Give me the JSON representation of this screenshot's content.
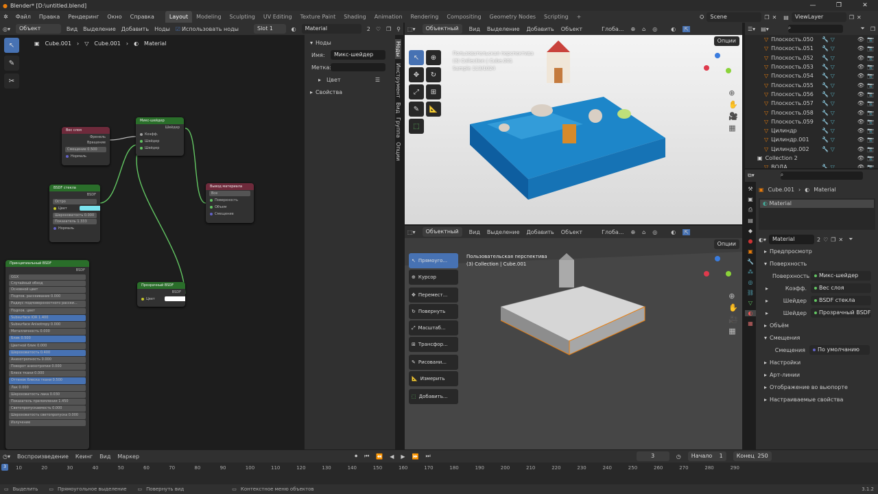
{
  "window": {
    "title": "Blender* [D:\\untitled.blend]",
    "min": "—",
    "max": "❐",
    "close": "✕"
  },
  "menu": {
    "items": [
      "Файл",
      "Правка",
      "Рендеринг",
      "Окно",
      "Справка"
    ]
  },
  "workspaces": [
    "Layout",
    "Modeling",
    "Sculpting",
    "UV Editing",
    "Texture Paint",
    "Shading",
    "Animation",
    "Rendering",
    "Compositing",
    "Geometry Nodes",
    "Scripting",
    "+"
  ],
  "top_right": {
    "scene": "Scene",
    "viewlayer": "ViewLayer"
  },
  "node_editor": {
    "header": {
      "mode": "Объект",
      "view": "Вид",
      "select": "Выделение",
      "add": "Добавить",
      "node": "Ноды",
      "use_nodes": "Использовать ноды",
      "slot": "Slot 1",
      "material": "Material",
      "users": "2"
    },
    "breadcrumb": [
      "Cube.001",
      "Cube.001",
      "Material"
    ],
    "nodes": {
      "layer_weight": {
        "title": "Вес слоя",
        "rows": [
          "Френель",
          "Вращение"
        ],
        "field": "Смещение  0.500",
        "input": "Нормаль"
      },
      "mix_shader": {
        "title": "Микс-шейдер",
        "out": "Шейдер",
        "rows": [
          "Коэфф.",
          "Шейдер",
          "Шейдер"
        ]
      },
      "glass": {
        "title": "BSDF стекла",
        "out": "BSDF",
        "dist": "Острo",
        "color_label": "Цвет",
        "fields": [
          "Шероховатость  0.000",
          "Показатель  1.333"
        ],
        "input": "Нормаль"
      },
      "output": {
        "title": "Вывод материала",
        "target": "Все",
        "rows": [
          "Поверхность",
          "Объем",
          "Смещение"
        ]
      },
      "principled": {
        "title": "Принципиальный BSDF",
        "out": "BSDF",
        "dist": "GGX",
        "sss": "Случайный обход",
        "rows": [
          "Основной цвет",
          "Подпов. рассеивание  0.000",
          "Радиус подповерхностного рассеи...",
          "Подпов. цвет",
          "Subsurface IOR  1.400",
          "Subsurface Anisotropy  0.000",
          "Металличность  0.000",
          "Блик  0.500",
          "Цветной блик  0.000",
          "Шероховатость  0.400",
          "Анизотропность  0.000",
          "Поворот анизотропии  0.000",
          "Блеск ткани  0.000",
          "Оттенок блеска ткани  0.500",
          "Лак  0.000",
          "Шероховатость лака  0.030",
          "Показатель преломления  1.450",
          "Светопропускаемость  0.000",
          "Шероховатость светопропуска  0.000",
          "Излучение"
        ]
      },
      "transparent": {
        "title": "Прозрачный BSDF",
        "out": "BSDF",
        "color_label": "Цвет"
      }
    }
  },
  "sidebar": {
    "section": "Ноды",
    "name_label": "Имя:",
    "name_value": "Микс-шейдер",
    "label_label": "Метка:",
    "color": "Цвет",
    "props": "Свойства",
    "tabs": [
      "Ноды",
      "Инструмент",
      "Вид",
      "Группа",
      "Опции"
    ]
  },
  "viewport_top": {
    "header": {
      "mode": "Объектный",
      "view": "Вид",
      "select": "Выделение",
      "add": "Добавить",
      "object": "Объект",
      "orient": "Глоба..."
    },
    "info": [
      "Пользовательская перспектива",
      "(3) Collection | Cube.001",
      "Sample 113/1024"
    ],
    "options": "Опции"
  },
  "viewport_bottom": {
    "header": {
      "mode": "Объектный",
      "view": "Вид",
      "select": "Выделение",
      "add": "Добавить",
      "object": "Объект",
      "orient": "Глоба..."
    },
    "info": [
      "Пользовательская перспектива",
      "(3) Collection | Cube.001"
    ],
    "options": "Опции",
    "tools": [
      "Прямоуго...",
      "Курсор",
      "Перемест...",
      "Повернуть",
      "Масштаб...",
      "Трансфор...",
      "Рисовани...",
      "Измерить",
      "Добавить..."
    ]
  },
  "outliner": {
    "items": [
      "Плоскость.050",
      "Плоскость.051",
      "Плоскость.052",
      "Плоскость.053",
      "Плоскость.054",
      "Плоскость.055",
      "Плоскость.056",
      "Плоскость.057",
      "Плоскость.058",
      "Плоскость.059",
      "Цилиндр",
      "Цилиндр.001",
      "Цилиндр.002",
      "Collection 2",
      "ВОДА"
    ]
  },
  "properties": {
    "breadcrumb": [
      "Cube.001",
      "Material"
    ],
    "slot": "Material",
    "material": "Material",
    "users": "2",
    "panels": {
      "preview": "Предпросмотр",
      "surface": "Поверхность",
      "volume": "Объём",
      "displacement": "Смещения",
      "settings": "Настройки",
      "line_art": "Арт-линии",
      "viewport": "Отображение во вьюпорте",
      "custom": "Настраиваемые свойства"
    },
    "surface_rows": [
      {
        "label": "Поверхность",
        "value": "Микс-шейдер"
      },
      {
        "label": "Коэфф.",
        "value": "Вес слоя"
      },
      {
        "label": "Шейдер",
        "value": "BSDF стекла"
      },
      {
        "label": "Шейдер",
        "value": "Прозрачный BSDF"
      }
    ],
    "disp_row": {
      "label": "Смещения",
      "value": "По умолчанию"
    }
  },
  "timeline": {
    "playback": "Воспроизведение",
    "keying": "Кеинг",
    "view": "Вид",
    "marker": "Маркер",
    "frame": "3",
    "start_label": "Начало",
    "start": "1",
    "end_label": "Конец",
    "end": "250",
    "ticks": [
      "10",
      "20",
      "30",
      "40",
      "50",
      "60",
      "70",
      "80",
      "90",
      "100",
      "110",
      "120",
      "130",
      "140",
      "150",
      "160",
      "170",
      "180",
      "190",
      "200",
      "210",
      "220",
      "230",
      "240",
      "250",
      "260",
      "270",
      "280",
      "290"
    ],
    "current": "3"
  },
  "status": {
    "select": "Выделить",
    "box": "Прямоугольное выделение",
    "rotate": "Повернуть вид",
    "context": "Контекстное меню объектов",
    "version": "3.1.2"
  }
}
